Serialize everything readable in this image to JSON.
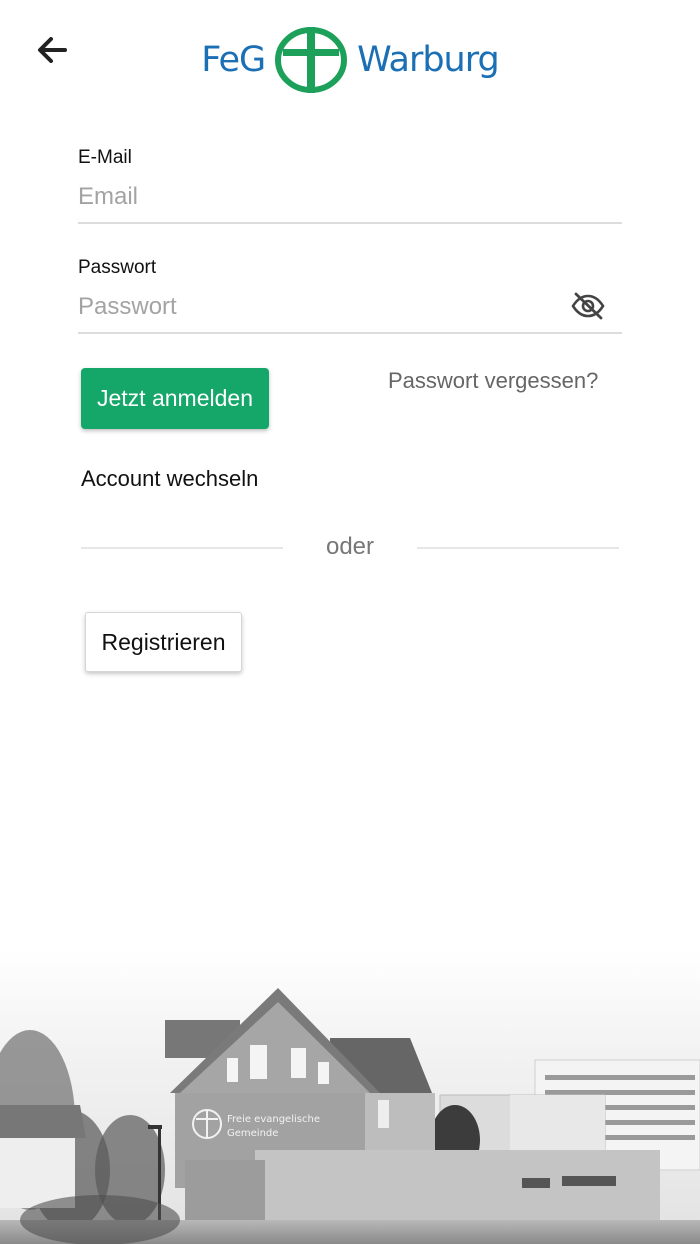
{
  "header": {
    "back_icon": "arrow-left-icon",
    "logo": {
      "left_text": "FeG",
      "right_text": "Warburg",
      "icon": "cross-circle-icon",
      "colors": {
        "text": "#1a6fb5",
        "cross": "#1ca05a"
      }
    }
  },
  "form": {
    "email": {
      "label": "E-Mail",
      "placeholder": "Email",
      "value": ""
    },
    "password": {
      "label": "Passwort",
      "placeholder": "Passwort",
      "value": "",
      "toggle_icon": "eye-slash-icon"
    },
    "login_button": "Jetzt anmelden",
    "forgot_link": "Passwort vergessen?",
    "switch_account": "Account wechseln",
    "divider_text": "oder",
    "register_button": "Registrieren"
  },
  "footer_image": {
    "sign_line1": "Freie evangelische",
    "sign_line2": "Gemeinde"
  },
  "colors": {
    "accent": "#15a66a",
    "logo_blue": "#1a6fb5",
    "divider": "#e6e6e6",
    "placeholder": "#a3a3a3"
  }
}
